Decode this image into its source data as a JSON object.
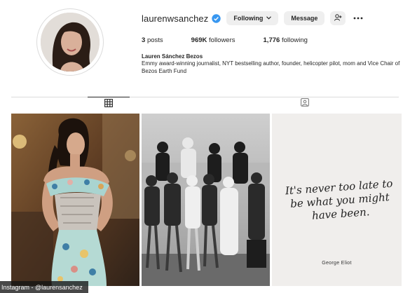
{
  "profile": {
    "username": "laurenwsanchez",
    "verified_icon": "verified-badge-icon",
    "following_button": "Following",
    "message_button": "Message",
    "add_user_icon": "add-user-icon",
    "more_icon": "more-options-icon",
    "stats": [
      {
        "count": "3",
        "label": "posts"
      },
      {
        "count": "969K",
        "label": "followers"
      },
      {
        "count": "1,776",
        "label": "following"
      }
    ],
    "full_name": "Lauren Sánchez Bezos",
    "bio": "Emmy award-winning journalist, NYT bestselling author, founder, helicopter pilot, mom and Vice Chair of Bezos Earth Fund"
  },
  "tabs": [
    {
      "icon": "grid-icon",
      "active": true
    },
    {
      "icon": "tagged-icon",
      "active": false
    }
  ],
  "posts": {
    "quote": "It's never too late to be what you might have been.",
    "quote_author": "George Eliot"
  },
  "credit": "Instagram - @laurensanchez",
  "colors": {
    "verified": "#3897f0",
    "button_bg": "#efefef",
    "text": "#262626"
  }
}
